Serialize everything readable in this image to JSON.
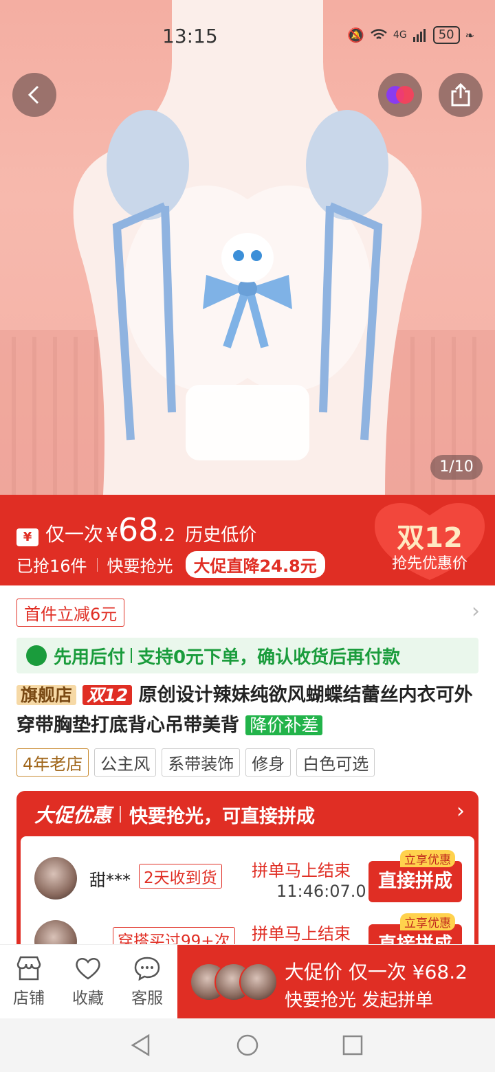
{
  "status_bar": {
    "time": "13:15",
    "network": "4G",
    "battery": "50"
  },
  "hero": {
    "counter": "1/10"
  },
  "price": {
    "once_label": "仅一次",
    "currency": "¥",
    "integer": "68",
    "decimal": ".2",
    "history_tag": "历史低价",
    "sold": "已抢16件",
    "hurry": "快要抢光",
    "promo_drop": "大促直降24.8元",
    "badge_title": "双12",
    "badge_sub": "抢先优惠价"
  },
  "coupon": {
    "label": "首件立减6元"
  },
  "pay_later": {
    "title": "先用后付",
    "desc": "支持0元下单，确认收货后再付款"
  },
  "product": {
    "tag_flagship": "旗舰店",
    "tag_d12": "双12",
    "title": "原创设计辣妹纯欲风蝴蝶结蕾丝内衣可外穿带胸垫打底背心吊带美背",
    "tag_price_diff": "降价补差"
  },
  "chips": [
    "4年老店",
    "公主风",
    "系带装饰",
    "修身",
    "白色可选"
  ],
  "group_buy": {
    "header": "大促优惠",
    "subheader": "快要抢光，可直接拼成",
    "rows": [
      {
        "name": "甜***",
        "badge": "2天收到货",
        "ending": "拼单马上结束",
        "countdown": "11:46:07.0",
        "button": "直接拼成",
        "hint": "立享优惠"
      },
      {
        "name": "",
        "badge": "穿搭买过99+次",
        "ending": "拼单马上结束",
        "countdown": "",
        "button": "直接拼成",
        "hint": "立享优惠"
      }
    ]
  },
  "bottom_bar": {
    "store": "店铺",
    "favorite": "收藏",
    "service": "客服",
    "cta_line1": "大促价 仅一次 ¥68.2",
    "cta_line2": "快要抢光 发起拼单"
  },
  "colors": {
    "accent": "#e02e24",
    "green": "#1a9c3c",
    "gold": "#f6d9a6"
  }
}
